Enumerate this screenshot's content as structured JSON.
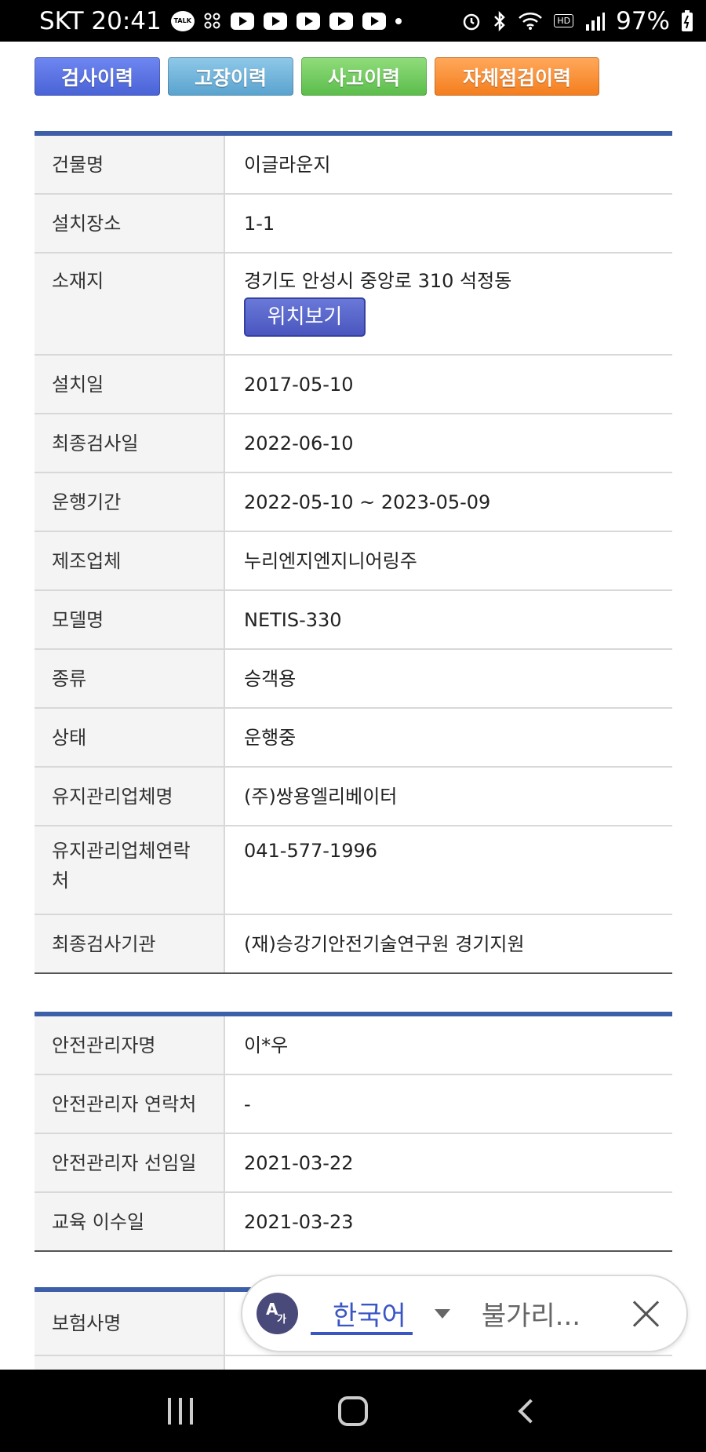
{
  "status_bar": {
    "carrier_time": "SKT 20:41",
    "talk_label": "TALK",
    "battery": "97%",
    "hd_label": "HD"
  },
  "tabs": [
    {
      "label": "검사이력",
      "color": "#4a63d6"
    },
    {
      "label": "고장이력",
      "color": "#5aa3cf"
    },
    {
      "label": "사고이력",
      "color": "#5cbd4c"
    },
    {
      "label": "자체점검이력",
      "color": "#f47e1e"
    }
  ],
  "building_info": {
    "rows": [
      {
        "label": "건물명",
        "value": "이글라운지"
      },
      {
        "label": "설치장소",
        "value": "1-1"
      },
      {
        "label": "소재지",
        "value": "경기도 안성시 중앙로 310 석정동",
        "button": "위치보기"
      },
      {
        "label": "설치일",
        "value": "2017-05-10"
      },
      {
        "label": "최종검사일",
        "value": "2022-06-10"
      },
      {
        "label": "운행기간",
        "value": "2022-05-10 ~ 2023-05-09"
      },
      {
        "label": "제조업체",
        "value": "누리엔지엔지니어링주"
      },
      {
        "label": "모델명",
        "value": "NETIS-330"
      },
      {
        "label": "종류",
        "value": "승객용"
      },
      {
        "label": "상태",
        "value": "운행중"
      },
      {
        "label": "유지관리업체명",
        "value": "(주)쌍용엘리베이터"
      },
      {
        "label": "유지관리업체연락처",
        "value": "041-577-1996"
      },
      {
        "label": "최종검사기관",
        "value": "(재)승강기안전기술연구원 경기지원"
      }
    ]
  },
  "safety_manager": {
    "rows": [
      {
        "label": "안전관리자명",
        "value": "이*우"
      },
      {
        "label": "안전관리자 연락처",
        "value": "-"
      },
      {
        "label": "안전관리자 선임일",
        "value": "2021-03-22"
      },
      {
        "label": "교육 이수일",
        "value": "2021-03-23"
      }
    ]
  },
  "insurance": {
    "rows": [
      {
        "label": "보험사명",
        "value": ""
      }
    ]
  },
  "translate_bar": {
    "icon_a": "A",
    "icon_ga": "가",
    "source_lang": "한국어",
    "target_lang": "불가리..."
  }
}
